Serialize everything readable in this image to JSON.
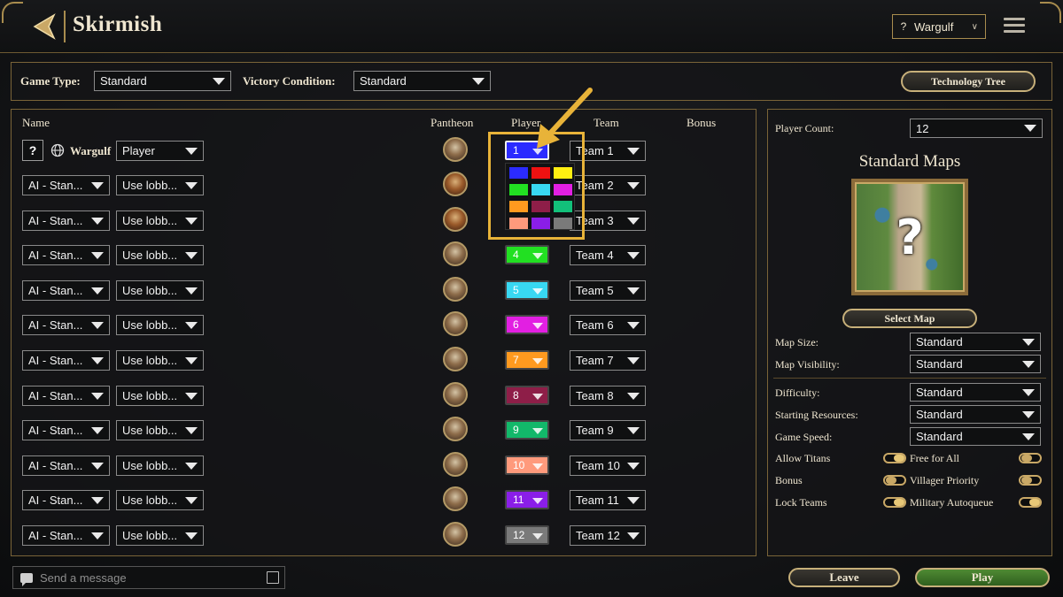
{
  "header": {
    "title": "Skirmish",
    "user": {
      "help": "?",
      "name": "Wargulf"
    }
  },
  "game_options": {
    "game_type_label": "Game Type:",
    "game_type_value": "Standard",
    "victory_label": "Victory Condition:",
    "victory_value": "Standard",
    "tech_tree_button": "Technology Tree"
  },
  "table": {
    "headers": {
      "name": "Name",
      "pantheon": "Pantheon",
      "player": "Player",
      "team": "Team",
      "bonus": "Bonus"
    },
    "human": {
      "help": "?",
      "name": "Wargulf",
      "type": "Player",
      "color_number": "1",
      "color": "#2b2bff",
      "team": "Team 1"
    },
    "ai_rows": [
      {
        "type": "AI - Stan...",
        "personality": "Use lobb...",
        "team": "Team 2"
      },
      {
        "type": "AI - Stan...",
        "personality": "Use lobb...",
        "team": "Team 3"
      },
      {
        "type": "AI - Stan...",
        "personality": "Use lobb...",
        "color_number": "4",
        "color": "#22e022",
        "team": "Team 4"
      },
      {
        "type": "AI - Stan...",
        "personality": "Use lobb...",
        "color_number": "5",
        "color": "#38d8f2",
        "team": "Team 5"
      },
      {
        "type": "AI - Stan...",
        "personality": "Use lobb...",
        "color_number": "6",
        "color": "#e21fe2",
        "team": "Team 6"
      },
      {
        "type": "AI - Stan...",
        "personality": "Use lobb...",
        "color_number": "7",
        "color": "#ff9a1f",
        "team": "Team 7"
      },
      {
        "type": "AI - Stan...",
        "personality": "Use lobb...",
        "color_number": "8",
        "color": "#8e1e48",
        "team": "Team 8"
      },
      {
        "type": "AI - Stan...",
        "personality": "Use lobb...",
        "color_number": "9",
        "color": "#12b86a",
        "team": "Team 9"
      },
      {
        "type": "AI - Stan...",
        "personality": "Use lobb...",
        "color_number": "10",
        "color": "#ff9a7c",
        "team": "Team 10"
      },
      {
        "type": "AI - Stan...",
        "personality": "Use lobb...",
        "color_number": "11",
        "color": "#8a1ee8",
        "team": "Team 11"
      },
      {
        "type": "AI - Stan...",
        "personality": "Use lobb...",
        "color_number": "12",
        "color": "#7a7a7a",
        "team": "Team 12"
      }
    ]
  },
  "color_picker": {
    "colors": [
      "#2b2bff",
      "#ee1111",
      "#ffee11",
      "#22e022",
      "#38d8f2",
      "#e21fe2",
      "#ff9a1f",
      "#8e1e48",
      "#12c07a",
      "#ff9a7c",
      "#8a1ee8",
      "#7a7a7a"
    ]
  },
  "settings": {
    "player_count_label": "Player Count:",
    "player_count_value": "12",
    "map_title": "Standard Maps",
    "select_map_button": "Select Map",
    "map_size_label": "Map Size:",
    "map_size_value": "Standard",
    "map_visibility_label": "Map Visibility:",
    "map_visibility_value": "Standard",
    "difficulty_label": "Difficulty:",
    "difficulty_value": "Standard",
    "starting_resources_label": "Starting Resources:",
    "starting_resources_value": "Standard",
    "game_speed_label": "Game Speed:",
    "game_speed_value": "Standard",
    "toggles": [
      {
        "label": "Allow Titans",
        "on": true
      },
      {
        "label": "Free for All",
        "on": false
      },
      {
        "label": "Bonus",
        "on": false
      },
      {
        "label": "Villager Priority",
        "on": false
      },
      {
        "label": "Lock Teams",
        "on": true
      },
      {
        "label": "Military Autoqueue",
        "on": true
      }
    ]
  },
  "footer": {
    "chat_placeholder": "Send a message",
    "leave_button": "Leave",
    "play_button": "Play"
  }
}
